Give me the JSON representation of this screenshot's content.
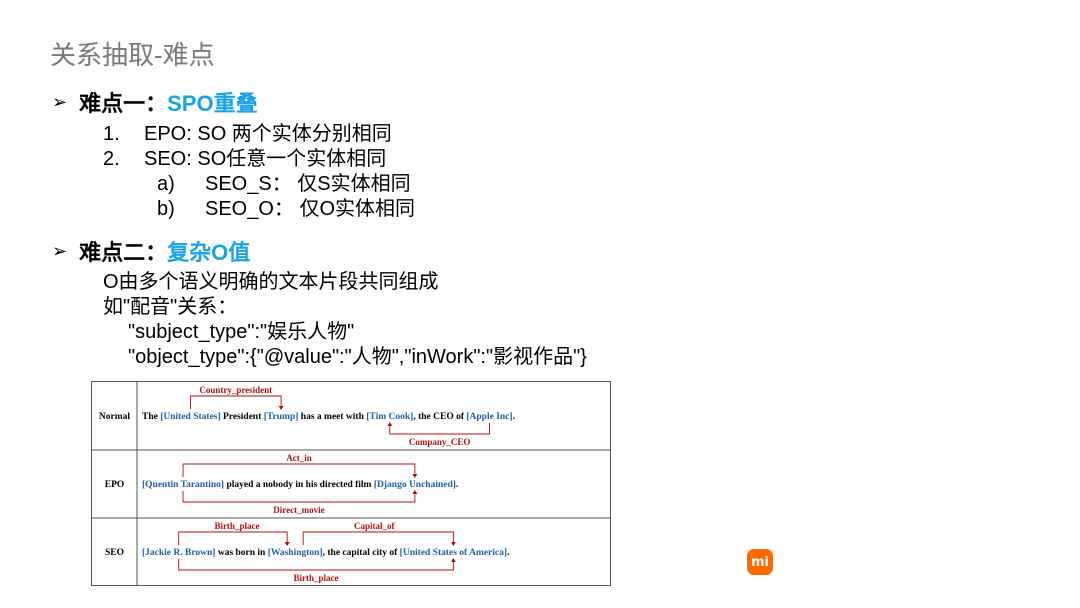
{
  "slide": {
    "title": "关系抽取-难点",
    "section1": {
      "bullet": "➢",
      "label": "难点一：",
      "highlight": "SPO重叠",
      "items": [
        {
          "num": "1.",
          "text": "EPO:  SO 两个实体分别相同"
        },
        {
          "num": "2.",
          "text": "SEO:  SO任意一个实体相同"
        },
        {
          "num": "a)",
          "text": "SEO_S：  仅S实体相同"
        },
        {
          "num": "b)",
          "text": "SEO_O：  仅O实体相同"
        }
      ]
    },
    "section2": {
      "bullet": "➢",
      "label": "难点二：",
      "highlight": "复杂O值",
      "lines": [
        "O由多个语义明确的文本片段共同组成",
        "如\"配音\"关系：",
        "\"subject_type\":\"娱乐人物\"",
        "\"object_type\":{\"@value\":\"人物\",\"inWork\":\"影视作品\"}"
      ]
    }
  },
  "figure": {
    "rows": [
      {
        "label": "Normal",
        "segments": [
          {
            "t": "The ",
            "c": "black"
          },
          {
            "t": "[United States]",
            "c": "blue"
          },
          {
            "t": " President ",
            "c": "black"
          },
          {
            "t": "[Trump]",
            "c": "blue"
          },
          {
            "t": " has a meet with ",
            "c": "black"
          },
          {
            "t": "[Tim Cook]",
            "c": "blue"
          },
          {
            "t": ", the CEO of ",
            "c": "black"
          },
          {
            "t": "[Apple Inc]",
            "c": "blue"
          },
          {
            "t": ".",
            "c": "black"
          }
        ],
        "relations_top": [
          "Country_president"
        ],
        "relations_bottom": [
          "Company_CEO"
        ]
      },
      {
        "label": "EPO",
        "segments": [
          {
            "t": "[Quentin Tarantino]",
            "c": "blue"
          },
          {
            "t": " played a nobody in his directed film ",
            "c": "black"
          },
          {
            "t": "[Django Unchained]",
            "c": "blue"
          },
          {
            "t": ".",
            "c": "black"
          }
        ],
        "relations_top": [
          "Act_in"
        ],
        "relations_bottom": [
          "Direct_movie"
        ]
      },
      {
        "label": "SEO",
        "segments": [
          {
            "t": "[Jackie R. Brown]",
            "c": "blue"
          },
          {
            "t": " was born in ",
            "c": "black"
          },
          {
            "t": "[Washington]",
            "c": "blue"
          },
          {
            "t": ", the capital city of ",
            "c": "black"
          },
          {
            "t": "[United States of America]",
            "c": "blue"
          },
          {
            "t": ".",
            "c": "black"
          }
        ],
        "relations_top": [
          "Birth_place",
          "Capital_of"
        ],
        "relations_bottom": [
          "Birth_place"
        ]
      }
    ],
    "colors": {
      "entity": "#1f5fa8",
      "relation": "#b01010",
      "text": "#000000",
      "border": "#555555"
    }
  },
  "logo": {
    "text": "mi",
    "color": "#ff6900"
  }
}
